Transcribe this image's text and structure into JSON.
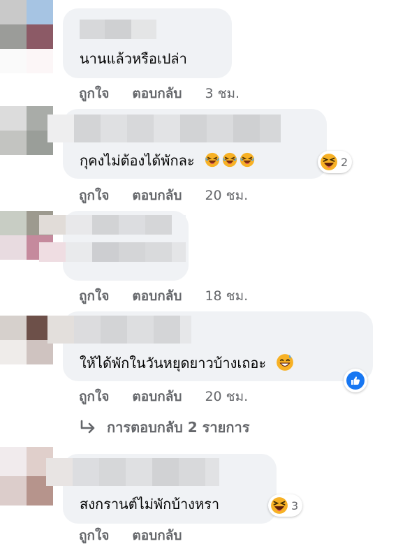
{
  "comments": [
    {
      "text": "นานแล้วหรือเปล่า",
      "time": "3 ชม."
    },
    {
      "text": "กุคงไม่ต้องได้พักละ",
      "time": "20 ชม.",
      "reaction_count": "2"
    },
    {
      "text": "",
      "time": "18 ชม."
    },
    {
      "text": "ให้ได้พักในวันหยุดยาวบ้างเถอะ",
      "time": "20 ชม."
    },
    {
      "text": "สงกรานต์ไม่พักบ้างหรา",
      "time": "",
      "reaction_count": "3"
    }
  ],
  "actions": {
    "like_label": "ถูกใจ",
    "reply_label": "ตอบกลับ"
  },
  "replies_link": "การตอบกลับ 2 รายการ",
  "colors": {
    "bubble": "#f0f2f5",
    "secondary_text": "#65676b",
    "like_blue": "#1877f2",
    "emoji_yellow": "#f7b125"
  },
  "icons": [
    "rolling-laughing-icon",
    "haha-reaction-icon",
    "like-reaction-icon",
    "grin-sweat-icon",
    "reply-arrow-icon"
  ]
}
